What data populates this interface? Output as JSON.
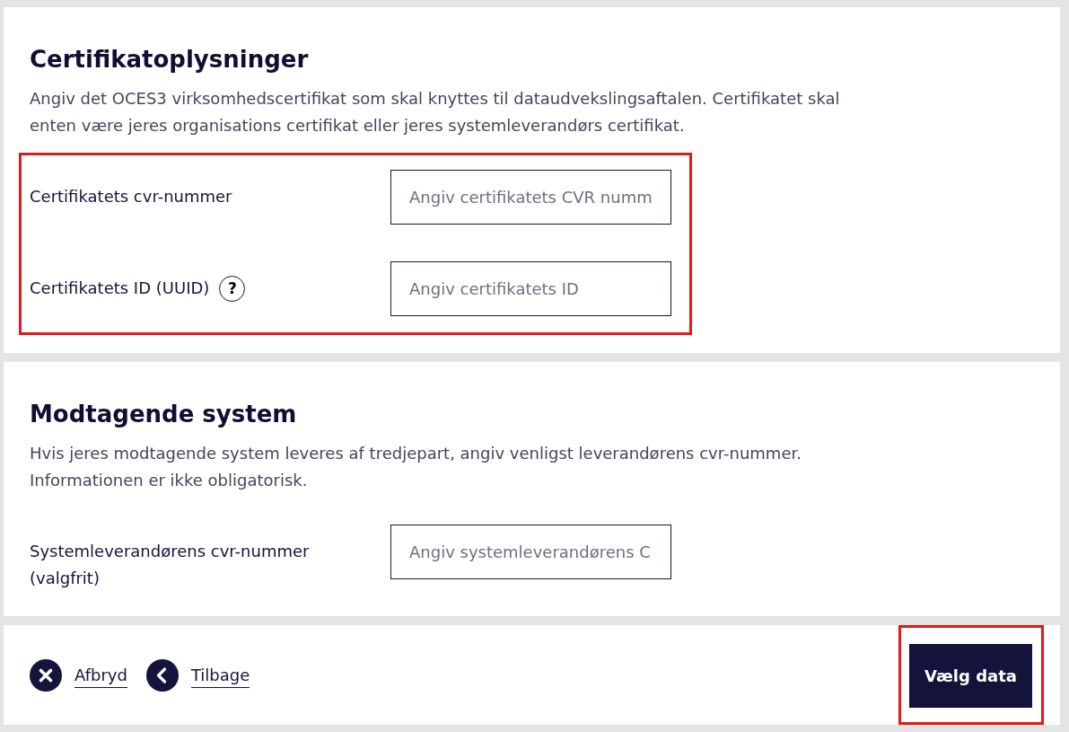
{
  "sections": [
    {
      "title": "Certifikatoplysninger",
      "description": "Angiv det OCES3 virksomhedscertifikat som skal knyttes til dataudvekslingsaftalen. Certifikatet skal enten være jeres organisations certifikat eller jeres systemleverandørs certifikat.",
      "highlighted": true,
      "fields": [
        {
          "label": "Certifikatets cvr-nummer",
          "placeholder": "Angiv certifikatets CVR numm"
        },
        {
          "label": "Certifikatets ID (UUID)",
          "help": "?",
          "placeholder": "Angiv certifikatets ID"
        }
      ]
    },
    {
      "title": "Modtagende system",
      "description": "Hvis jeres modtagende system leveres af tredjepart, angiv venligst leverandørens cvr-nummer. Informationen er ikke obligatorisk.",
      "highlighted": false,
      "fields": [
        {
          "label": "Systemleverandørens cvr-nummer (valgfrit)",
          "placeholder": "Angiv systemleverandørens C"
        }
      ]
    }
  ],
  "footer": {
    "links": [
      {
        "kind": "cancel",
        "label": "Afbryd"
      },
      {
        "kind": "back",
        "label": "Tilbage"
      }
    ],
    "primary_button": {
      "label": "Vælg data",
      "highlighted": true
    }
  }
}
